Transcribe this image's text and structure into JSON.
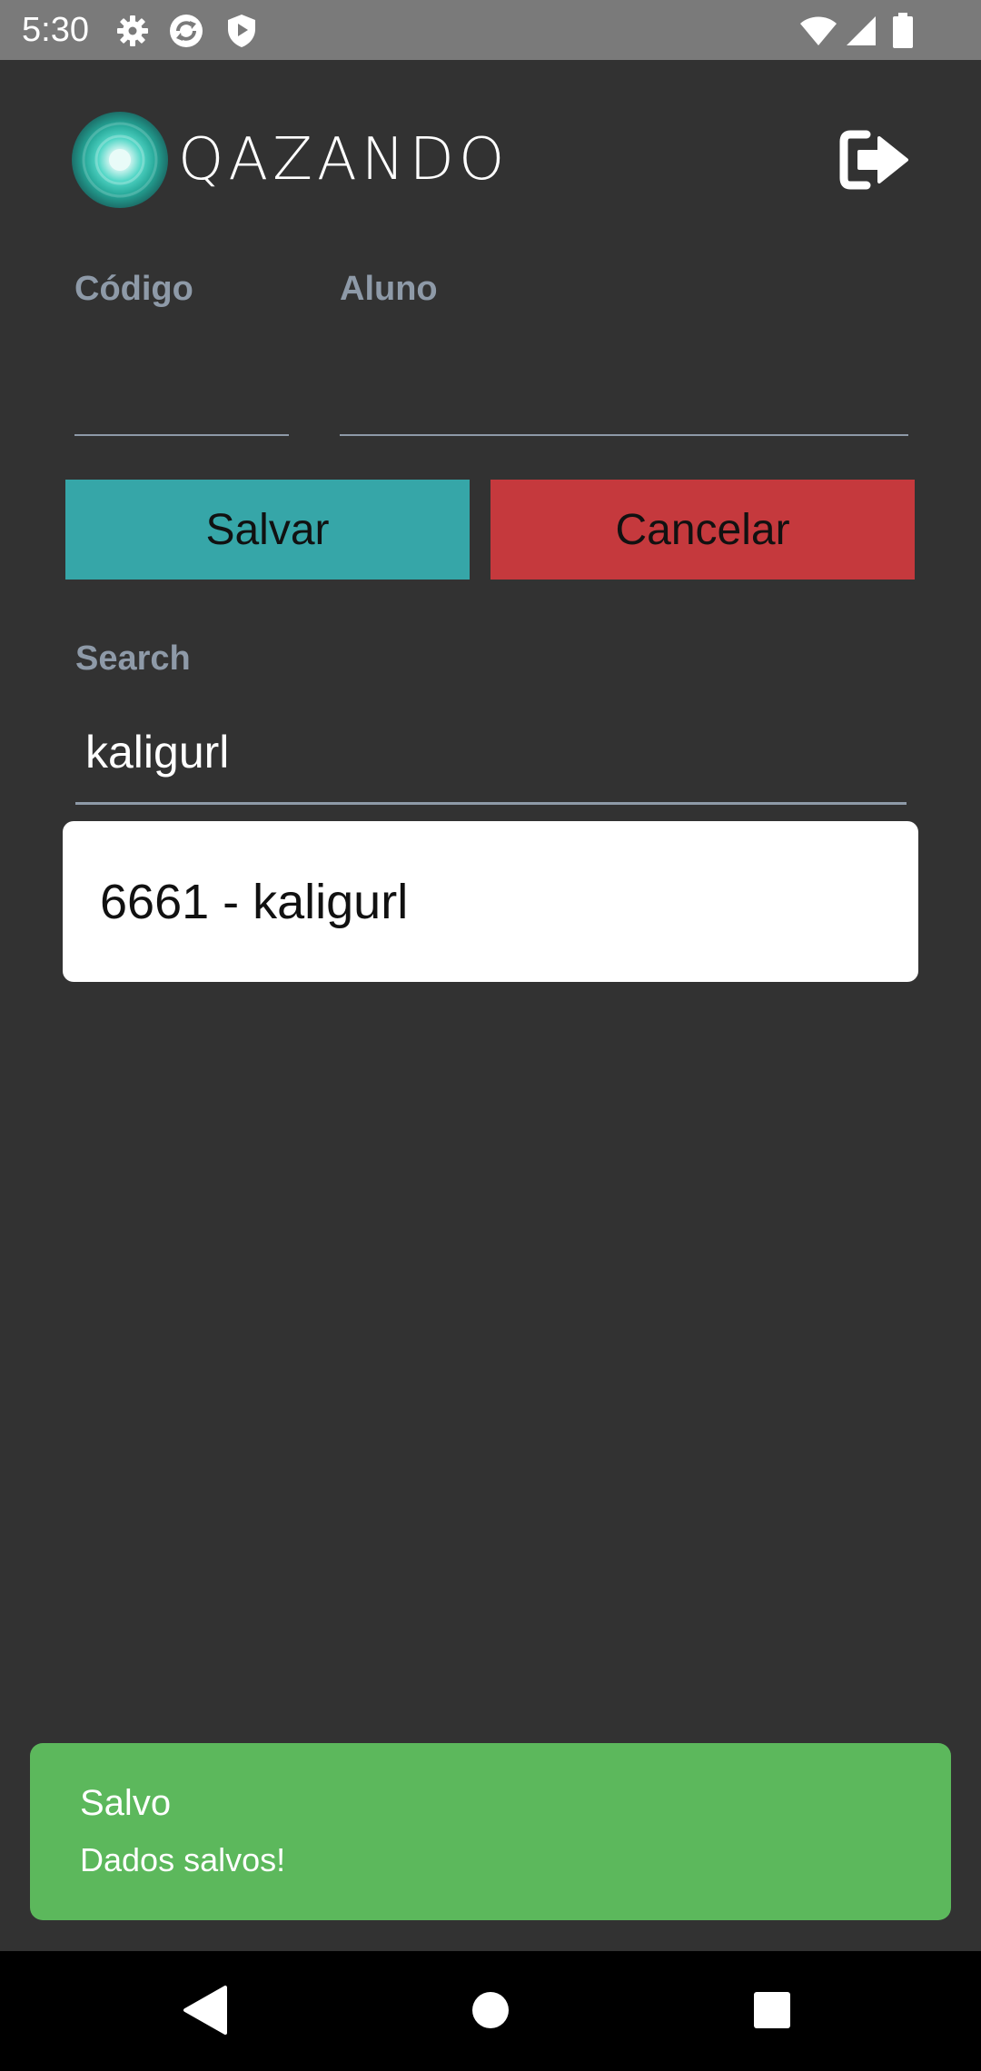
{
  "status_bar": {
    "time": "5:30",
    "icons": [
      "gear-icon",
      "sync-icon",
      "shield-play-icon",
      "wifi-icon",
      "signal-icon",
      "battery-icon"
    ]
  },
  "header": {
    "logo_text": "QAZANDO",
    "logout_icon": "logout-icon"
  },
  "form": {
    "codigo_label": "Código",
    "codigo_value": "",
    "aluno_label": "Aluno",
    "aluno_value": "",
    "save_label": "Salvar",
    "cancel_label": "Cancelar",
    "search_label": "Search",
    "search_value": "kaligurl"
  },
  "results": [
    {
      "text": "6661 - kaligurl"
    }
  ],
  "toast": {
    "title": "Salvo",
    "message": "Dados salvos!"
  },
  "nav": {
    "icons": [
      "back-icon",
      "home-icon",
      "recents-icon"
    ]
  },
  "colors": {
    "background": "#323232",
    "status_bar": "#7a7a7a",
    "save_button": "#36a6a8",
    "cancel_button": "#c5393d",
    "toast": "#5cb85c",
    "label": "#8e9aa8"
  }
}
